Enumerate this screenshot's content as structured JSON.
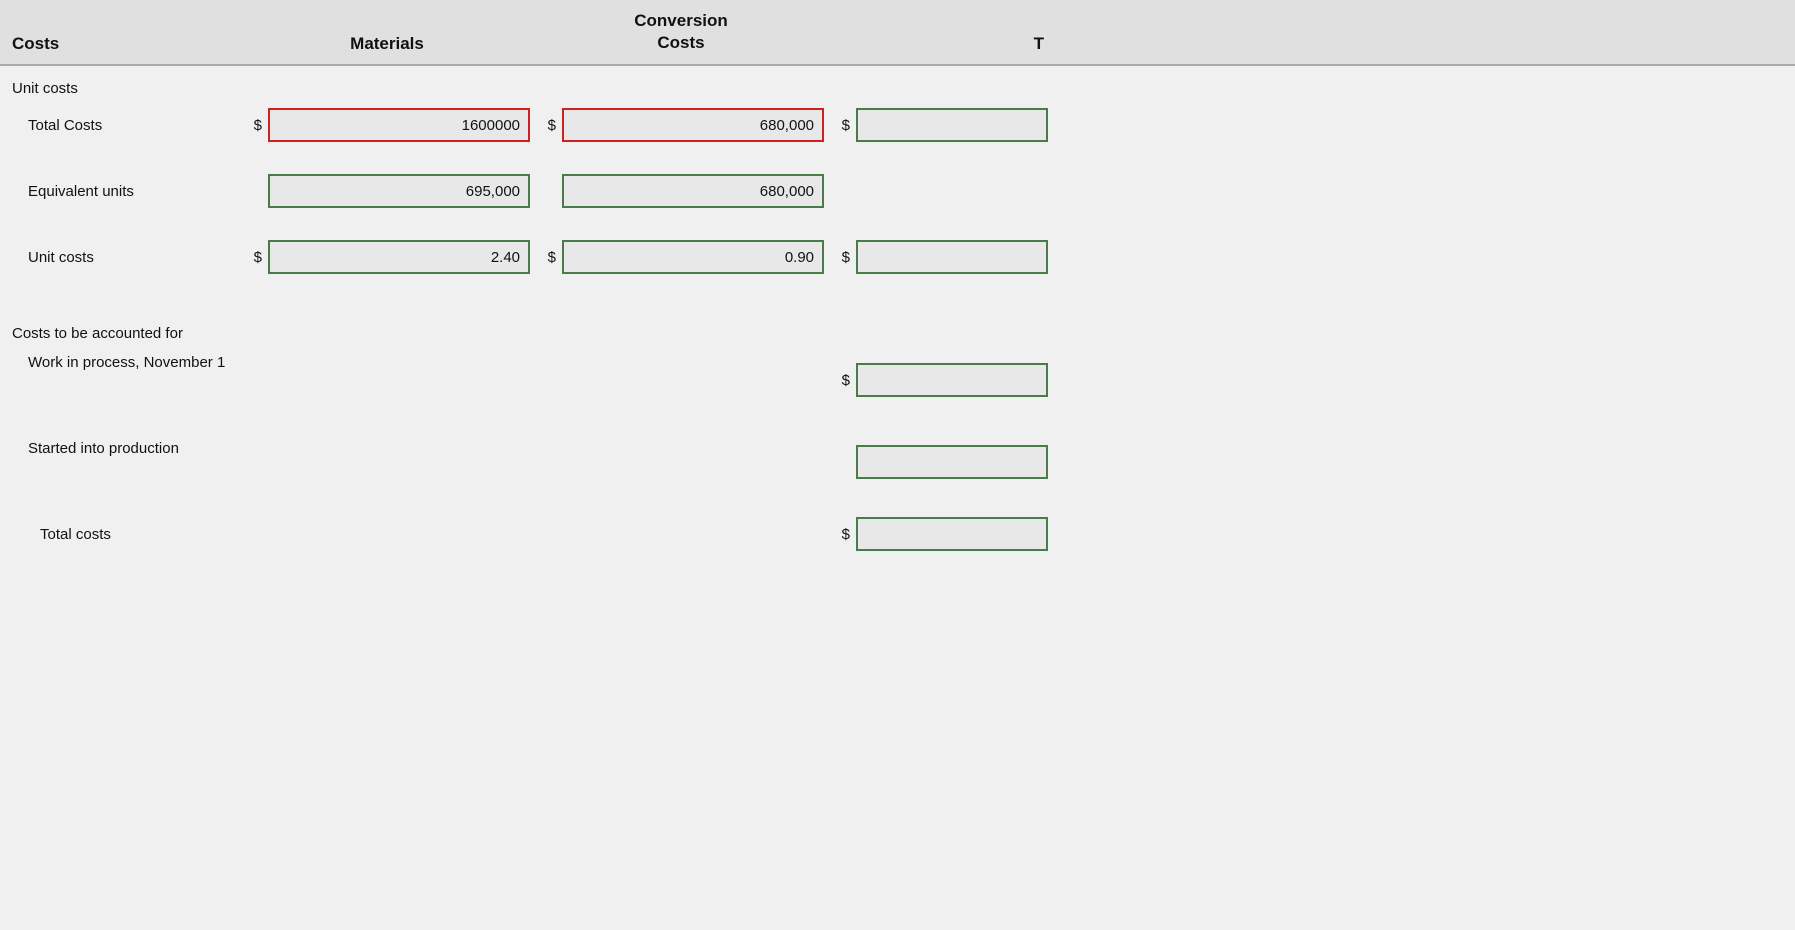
{
  "header": {
    "col_label": "Costs",
    "col_materials": "Materials",
    "col_conversion_line1": "Conversion",
    "col_conversion_line2": "Costs",
    "col_total": "T"
  },
  "sections": {
    "unit_costs_header": "Unit costs",
    "total_costs_label": "Total Costs",
    "equivalent_units_label": "Equivalent units",
    "unit_costs_label": "Unit costs",
    "costs_accounted_header": "Costs to be accounted for",
    "work_in_process_label": "Work in process, November 1",
    "started_production_label": "Started into production",
    "total_costs_label2": "Total costs"
  },
  "values": {
    "total_costs_materials": "1600000",
    "total_costs_conversion": "680,000",
    "total_costs_total": "",
    "equiv_units_materials": "695,000",
    "equiv_units_conversion": "680,000",
    "unit_cost_materials": "2.40",
    "unit_cost_conversion": "0.90",
    "unit_cost_total": "",
    "wip_total": "",
    "started_total": "",
    "total_costs2": ""
  },
  "currency_symbol": "$"
}
